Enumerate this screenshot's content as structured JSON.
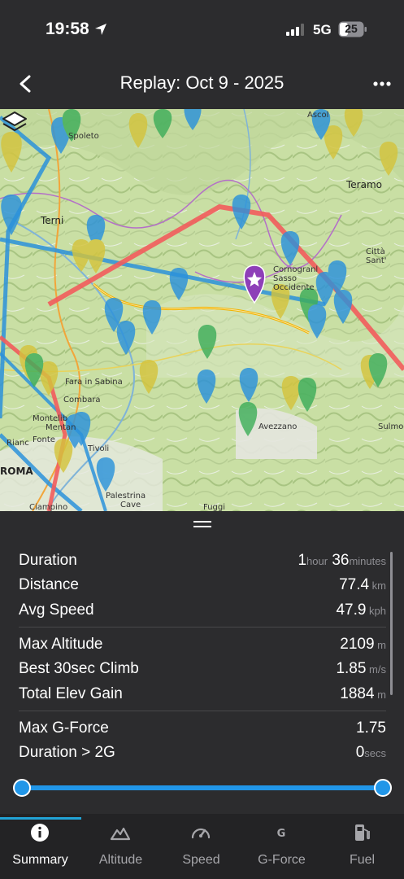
{
  "status": {
    "time": "19:58",
    "network": "5G",
    "battery": "25"
  },
  "nav": {
    "title": "Replay:  Oct 9 - 2025"
  },
  "map": {
    "cities": [
      "Spoleto",
      "Terni",
      "Teramo",
      "Città Sant'",
      "Cornogranl Sasso Occidente",
      "Fara in Sabina",
      "Avezzano",
      "Sulmon",
      "ROMA",
      "Rianc",
      "Montelib",
      "Mentan",
      "Fonte",
      "Ciampino",
      "Palestrina",
      "Cave",
      "Ascol",
      "Tivoli",
      "Fuggi",
      "Combara"
    ],
    "icons": [
      "layers-icon",
      "favorite-star-icon"
    ]
  },
  "summary": {
    "rows": [
      {
        "label": "Duration",
        "value_a": "1",
        "unit_a": "hour",
        "value_b": " 36",
        "unit_b": "minutes"
      },
      {
        "label": "Distance",
        "value_a": "77.4",
        "unit_a": " km"
      },
      {
        "label": "Avg Speed",
        "value_a": "47.9",
        "unit_a": " kph"
      },
      {
        "label": "Max Altitude",
        "value_a": "2109",
        "unit_a": " m"
      },
      {
        "label": "Best 30sec Climb",
        "value_a": "1.85",
        "unit_a": " m/s"
      },
      {
        "label": "Total Elev Gain",
        "value_a": "1884",
        "unit_a": " m"
      },
      {
        "label": "Max G-Force",
        "value_a": "1.75",
        "unit_a": ""
      },
      {
        "label": "Duration > 2G",
        "value_a": "0",
        "unit_a": "secs"
      }
    ]
  },
  "slider": {
    "start": 0.0,
    "end": 1.0
  },
  "tabs": [
    {
      "label": "Summary",
      "icon": "info-icon",
      "active": true
    },
    {
      "label": "Altitude",
      "icon": "mountain-icon",
      "active": false
    },
    {
      "label": "Speed",
      "icon": "speedometer-icon",
      "active": false
    },
    {
      "label": "G-Force",
      "icon": "g-force-icon",
      "active": false
    },
    {
      "label": "Fuel",
      "icon": "fuel-pump-icon",
      "active": false
    }
  ],
  "colors": {
    "accent": "#2196e8",
    "background": "#2c2c2e",
    "tabbar": "#232325"
  }
}
